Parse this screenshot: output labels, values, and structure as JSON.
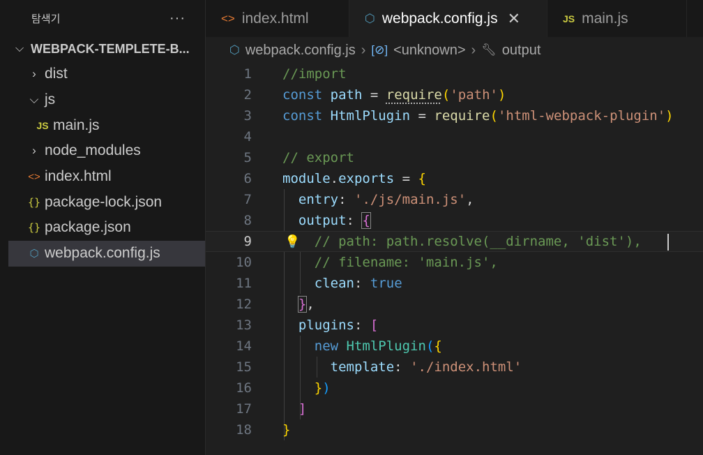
{
  "sidebar": {
    "title": "탐색기",
    "more": "···",
    "project": "WEBPACK-TEMPLETE-B...",
    "items": [
      {
        "label": "dist",
        "icon": "chevron-right-icon"
      },
      {
        "label": "js",
        "icon": "chevron-down-icon"
      },
      {
        "label": "main.js",
        "icon": "js-file-icon"
      },
      {
        "label": "node_modules",
        "icon": "chevron-right-icon"
      },
      {
        "label": "index.html",
        "icon": "html-file-icon"
      },
      {
        "label": "package-lock.json",
        "icon": "json-file-icon"
      },
      {
        "label": "package.json",
        "icon": "json-file-icon"
      },
      {
        "label": "webpack.config.js",
        "icon": "webpack-file-icon",
        "selected": true
      }
    ]
  },
  "tabs": [
    {
      "label": "index.html",
      "icon": "html-file-icon"
    },
    {
      "label": "webpack.config.js",
      "icon": "webpack-file-icon",
      "active": true
    },
    {
      "label": "main.js",
      "icon": "js-file-icon"
    }
  ],
  "breadcrumb": {
    "file": "webpack.config.js",
    "symbol": "<unknown>",
    "property": "output"
  },
  "editor": {
    "current_line": 9,
    "lines": [
      "//import",
      "const path = require('path')",
      "const HtmlPlugin = require('html-webpack-plugin')",
      "",
      "// export",
      "module.exports = {",
      "  entry: './js/main.js',",
      "  output: {",
      "    // path: path.resolve(__dirname, 'dist'),",
      "    // filename: 'main.js',",
      "    clean: true",
      "  },",
      "  plugins: [",
      "    new HtmlPlugin({",
      "      template: './index.html'",
      "    })",
      "  ]",
      "}"
    ]
  },
  "colors": {
    "comment": "#6a9955",
    "keyword": "#569cd6",
    "string": "#ce9178",
    "function": "#dcdcaa"
  }
}
